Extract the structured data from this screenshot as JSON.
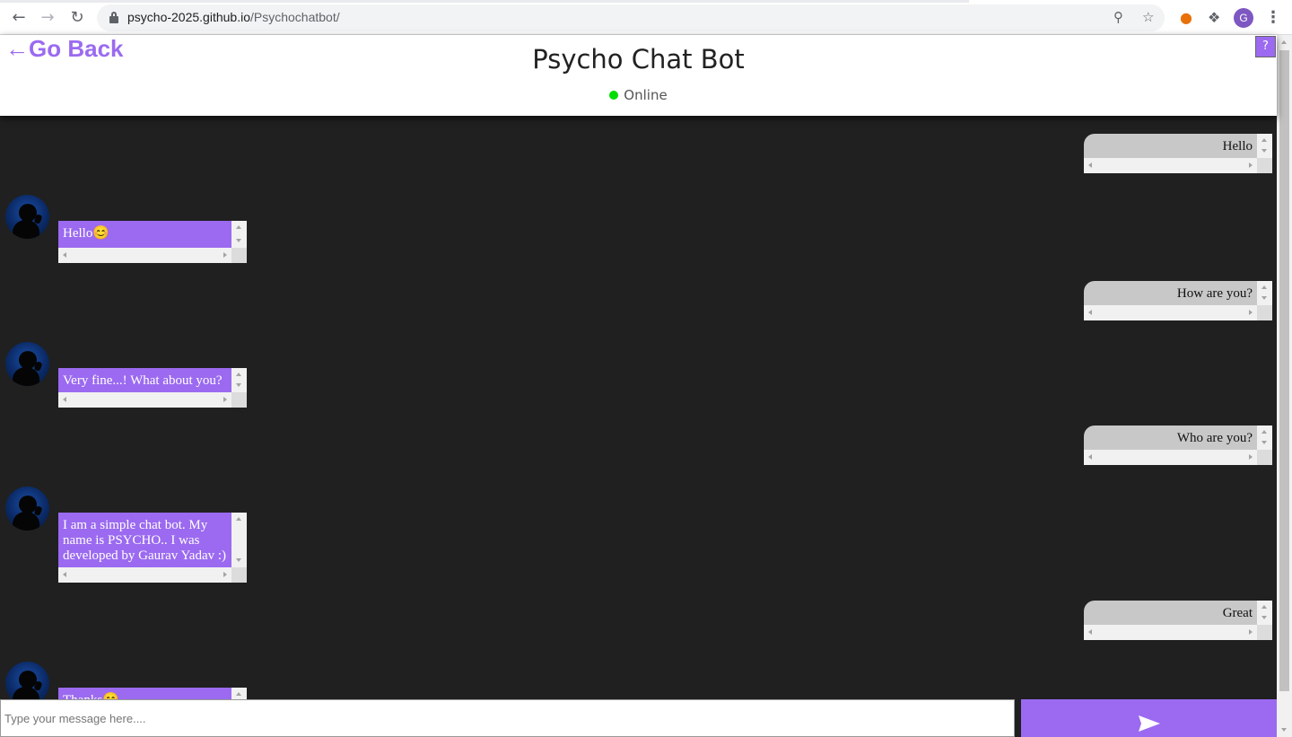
{
  "browser": {
    "url_host": "psycho-2025.github.io",
    "url_path": "/Psychochatbot/",
    "profile_initial": "G"
  },
  "header": {
    "go_back_label": "←Go Back",
    "title": "Psycho Chat Bot",
    "status_text": "Online",
    "status_color": "#00dd00",
    "help_label": "?"
  },
  "theme": {
    "accent": "#9b6af0",
    "chat_background": "#202020",
    "user_bubble": "#c8c8c8"
  },
  "messages": [
    {
      "sender": "user",
      "text": "Hello"
    },
    {
      "sender": "bot",
      "text": "Hello😊"
    },
    {
      "sender": "user",
      "text": "How are you?"
    },
    {
      "sender": "bot",
      "text": "Very fine...! What about you?"
    },
    {
      "sender": "user",
      "text": "Who are you?"
    },
    {
      "sender": "bot",
      "text": "I am a simple chat bot. My name is PSYCHO.. I was developed by Gaurav Yadav :)"
    },
    {
      "sender": "user",
      "text": "Great"
    },
    {
      "sender": "bot",
      "text": "Thanks😊"
    }
  ],
  "composer": {
    "placeholder": "Type your message here....",
    "send_icon": "send-arrow-icon"
  }
}
